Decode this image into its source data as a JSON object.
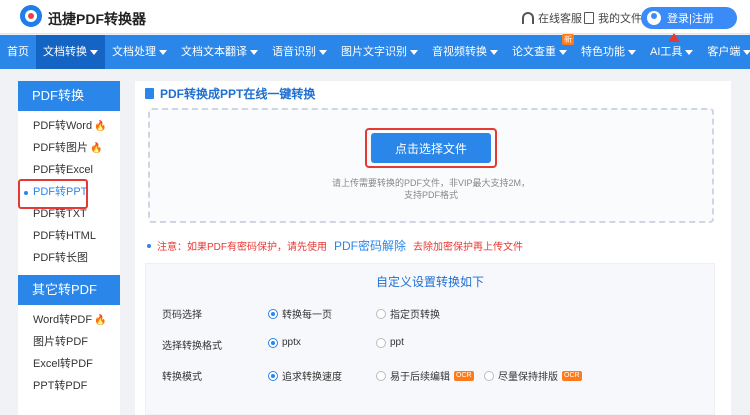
{
  "header": {
    "brand": "迅捷PDF转换器",
    "service_label": "在线客服",
    "files_label": "我的文件",
    "login_label": "登录|注册"
  },
  "nav": {
    "items": [
      {
        "label": "首页",
        "caret": false
      },
      {
        "label": "文档转换",
        "caret": true,
        "active": true
      },
      {
        "label": "文档处理",
        "caret": true
      },
      {
        "label": "文档文本翻译",
        "caret": true
      },
      {
        "label": "语音识别",
        "caret": true
      },
      {
        "label": "图片文字识别",
        "caret": true
      },
      {
        "label": "音视频转换",
        "caret": true
      },
      {
        "label": "论文查重",
        "caret": true,
        "badge": "新"
      },
      {
        "label": "特色功能",
        "caret": true
      },
      {
        "label": "AI工具",
        "caret": true,
        "arrow": true
      },
      {
        "label": "客户端",
        "caret": true
      }
    ]
  },
  "sidebar": {
    "section1_title": "PDF转换",
    "section1_items": [
      {
        "label": "PDF转Word",
        "hot": true
      },
      {
        "label": "PDF转图片",
        "hot": true
      },
      {
        "label": "PDF转Excel",
        "hot": false
      },
      {
        "label": "PDF转PPT",
        "hot": false,
        "selected": true
      },
      {
        "label": "PDF转TXT",
        "hot": false
      },
      {
        "label": "PDF转HTML",
        "hot": false
      },
      {
        "label": "PDF转长图",
        "hot": false
      }
    ],
    "section2_title": "其它转PDF",
    "section2_items": [
      {
        "label": "Word转PDF",
        "hot": true
      },
      {
        "label": "图片转PDF",
        "hot": false
      },
      {
        "label": "Excel转PDF",
        "hot": false
      },
      {
        "label": "PPT转PDF",
        "hot": false
      }
    ]
  },
  "main": {
    "title": "PDF转换成PPT在线一键转换",
    "upload_button": "点击选择文件",
    "hint_line1": "请上传需要转换的PDF文件，非VIP最大支持2M，",
    "hint_line2": "支持PDF格式",
    "notice_prefix": "注意：如果PDF有密码保护，请先使用",
    "notice_link": "PDF密码解除",
    "notice_suffix": "去除加密保护再上传文件",
    "settings_title": "自定义设置转换如下",
    "settings": {
      "page_label": "页码选择",
      "page_opt1": "转换每一页",
      "page_opt2": "指定页转换",
      "format_label": "选择转换格式",
      "format_opt1": "pptx",
      "format_opt2": "ppt",
      "mode_label": "转换模式",
      "mode_opt1": "追求转换速度",
      "mode_opt2": "易于后续编辑",
      "mode_opt3": "尽量保持排版",
      "ocr_badge": "OCR"
    }
  },
  "colors": {
    "primary": "#2a86e8",
    "nav_active": "#1464c3",
    "highlight": "#e53935",
    "hot": "#ff5a1f"
  }
}
